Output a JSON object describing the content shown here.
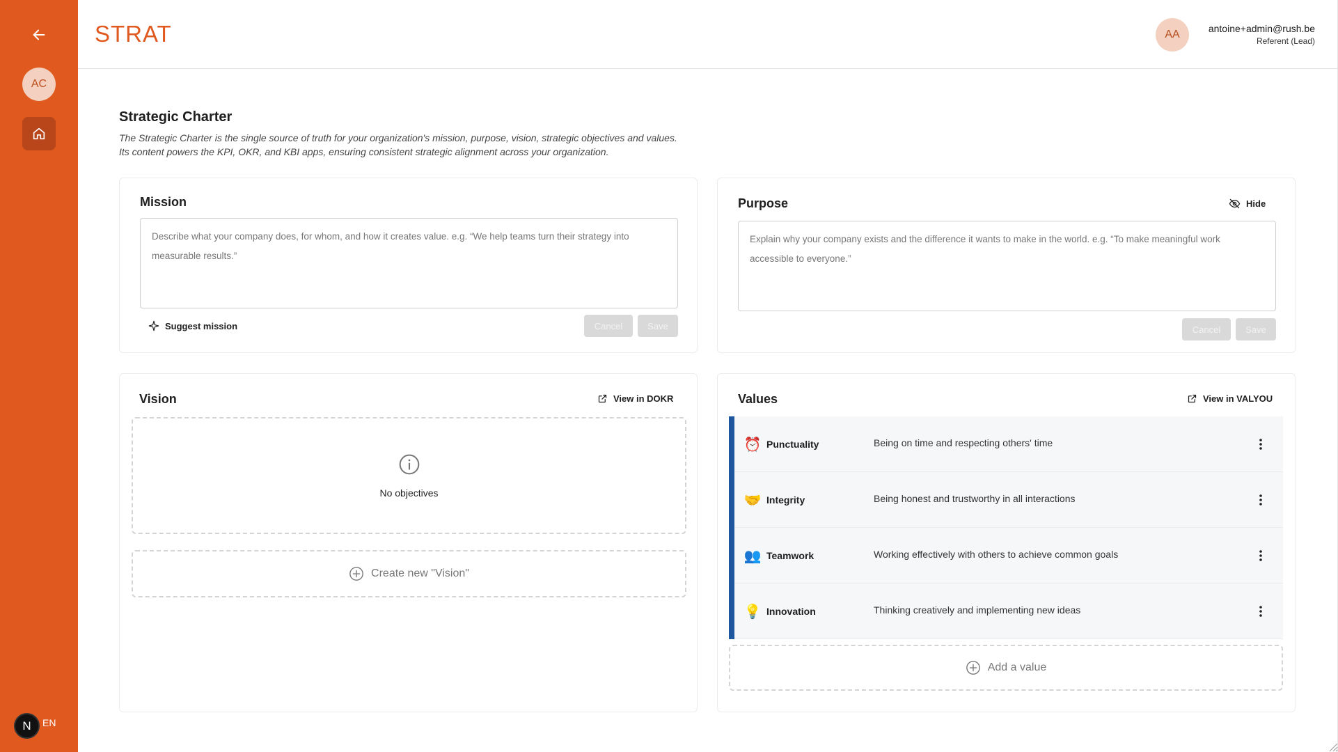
{
  "app": {
    "brand": "STRAT"
  },
  "sidebar": {
    "avatar_initials": "AC",
    "lang_badge": "N",
    "lang": "EN"
  },
  "user": {
    "initials": "AA",
    "email": "antoine+admin@rush.be",
    "role": "Referent (Lead)"
  },
  "page": {
    "title": "Strategic Charter",
    "description_line1": "The Strategic Charter is the single source of truth for your organization's mission, purpose, vision, strategic objectives and values.",
    "description_line2": "Its content powers the KPI, OKR, and KBI apps, ensuring consistent strategic alignment across your organization."
  },
  "mission": {
    "title": "Mission",
    "placeholder": "Describe what your company does, for whom, and how it creates value. e.g. “We help teams turn their strategy into measurable results.”",
    "suggest_label": "Suggest mission",
    "cancel_label": "Cancel",
    "save_label": "Save"
  },
  "purpose": {
    "title": "Purpose",
    "hide_label": "Hide",
    "placeholder": "Explain why your company exists and the difference it wants to make in the world. e.g. “To make meaningful work accessible to everyone.”",
    "cancel_label": "Cancel",
    "save_label": "Save"
  },
  "vision": {
    "title": "Vision",
    "view_label": "View in DOKR",
    "empty_label": "No objectives",
    "create_label": "Create new \"Vision\""
  },
  "values": {
    "title": "Values",
    "view_label": "View in VALYOU",
    "accent_color": "#1e56a0",
    "items": [
      {
        "emoji": "⏰",
        "name": "Punctuality",
        "description": "Being on time and respecting others' time"
      },
      {
        "emoji": "🤝",
        "name": "Integrity",
        "description": "Being honest and trustworthy in all interactions"
      },
      {
        "emoji": "👥",
        "name": "Teamwork",
        "description": "Working effectively with others to achieve common goals"
      },
      {
        "emoji": "💡",
        "name": "Innovation",
        "description": "Thinking creatively and implementing new ideas"
      }
    ],
    "add_label": "Add a value"
  },
  "colors": {
    "brand": "#e05a1f",
    "sidebar": "#e05a1f",
    "disabled": "#d9d9d9"
  }
}
